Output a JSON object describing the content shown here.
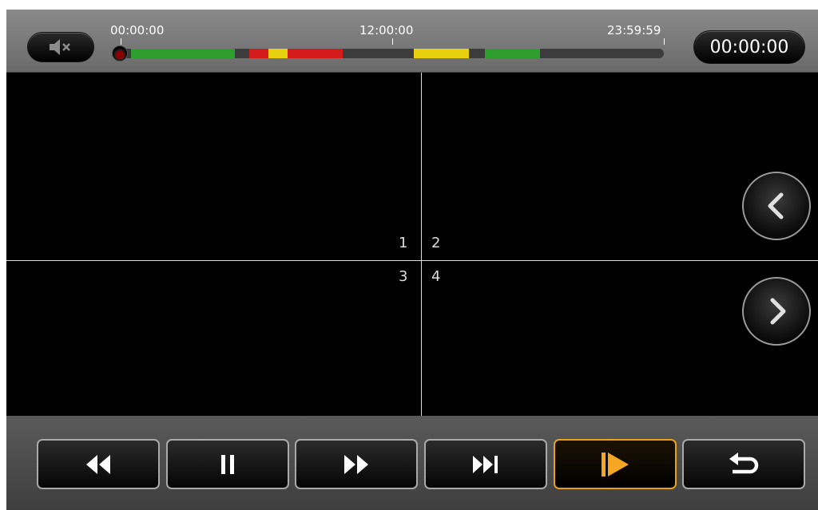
{
  "timeline": {
    "start_label": "00:00:00",
    "mid_label": "12:00:00",
    "end_label": "23:59:59",
    "segments": [
      {
        "color": "#2e9e2e",
        "start": 0.03,
        "end": 0.22
      },
      {
        "color": "#d41c1c",
        "start": 0.245,
        "end": 0.28
      },
      {
        "color": "#e6d010",
        "start": 0.28,
        "end": 0.315
      },
      {
        "color": "#d41c1c",
        "start": 0.315,
        "end": 0.415
      },
      {
        "color": "#e6d010",
        "start": 0.545,
        "end": 0.645
      },
      {
        "color": "#2e9e2e",
        "start": 0.675,
        "end": 0.775
      }
    ],
    "position": 0
  },
  "time_display": "00:00:00",
  "icons": {
    "mute": "mute-icon",
    "prev": "chevron-left-icon",
    "next": "chevron-right-icon"
  },
  "channels": [
    "1",
    "2",
    "3",
    "4"
  ],
  "controls": [
    {
      "name": "rewind",
      "icon": "rewind-icon"
    },
    {
      "name": "pause",
      "icon": "pause-icon"
    },
    {
      "name": "fast-forward",
      "icon": "fast-forward-icon"
    },
    {
      "name": "next-frame",
      "icon": "skip-next-icon"
    },
    {
      "name": "play",
      "icon": "play-icon",
      "active": true
    },
    {
      "name": "back",
      "icon": "return-icon"
    }
  ],
  "colors": {
    "accent": "#e8a21a"
  }
}
